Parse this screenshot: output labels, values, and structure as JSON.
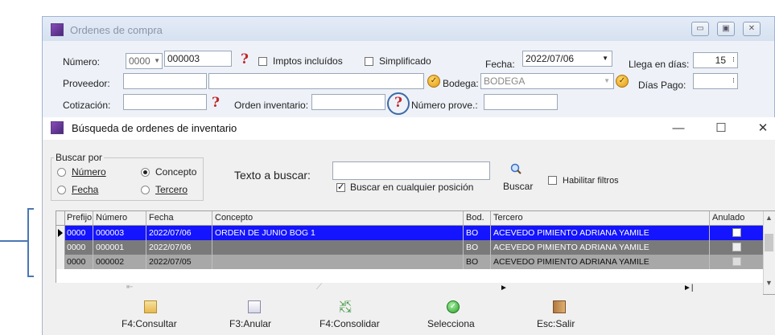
{
  "back_window": {
    "title": "Ordenes de compra",
    "numero_label": "Número:",
    "numero_prefix": "0000",
    "numero_value": "000003",
    "imptos_label": "Imptos incluídos",
    "simplificado_label": "Simplificado",
    "fecha_label": "Fecha:",
    "fecha_value": "2022/07/06",
    "llega_label": "Llega en días:",
    "llega_value": "15",
    "proveedor_label": "Proveedor:",
    "proveedor_code": "",
    "proveedor_name": "",
    "bodega_label": "Bodega:",
    "bodega_value": "BODEGA",
    "dias_pago_label": "Días Pago:",
    "dias_pago_value": "",
    "cotizacion_label": "Cotización:",
    "cotizacion_value": "",
    "orden_inv_label": "Orden inventario:",
    "orden_inv_value": "",
    "numero_prove_label": "Número prove.:",
    "numero_prove_value": ""
  },
  "dialog": {
    "title": "Búsqueda de ordenes de inventario",
    "minimize": "—",
    "maximize": "☐",
    "close": "✕",
    "buscar_por": "Buscar por",
    "radios": [
      {
        "label": "Número",
        "selected": false
      },
      {
        "label": "Concepto",
        "selected": true
      },
      {
        "label": "Fecha",
        "selected": false
      },
      {
        "label": "Tercero",
        "selected": false
      }
    ],
    "texto_label": "Texto a buscar:",
    "texto_value": "",
    "cualquier_label": "Buscar en cualquier posición",
    "cualquier_checked": true,
    "buscar_label": "Buscar",
    "filtros_label": "Habilitar filtros",
    "filtros_checked": false
  },
  "grid": {
    "columns": [
      "Prefijo",
      "Número",
      "Fecha",
      "Concepto",
      "Bod.",
      "Tercero",
      "Anulado"
    ],
    "rows": [
      {
        "prefijo": "0000",
        "numero": "000003",
        "fecha": "2022/07/06",
        "concepto": "ORDEN DE JUNIO BOG 1",
        "bod": "BO",
        "tercero": "ACEVEDO PIMIENTO ADRIANA YAMILE",
        "anulado": false
      },
      {
        "prefijo": "0000",
        "numero": "000001",
        "fecha": "2022/07/06",
        "concepto": "",
        "bod": "BO",
        "tercero": "ACEVEDO PIMIENTO ADRIANA YAMILE",
        "anulado": false
      },
      {
        "prefijo": "0000",
        "numero": "000002",
        "fecha": "2022/07/05",
        "concepto": "",
        "bod": "BO",
        "tercero": "ACEVEDO PIMIENTO ADRIANA YAMILE",
        "anulado": false
      }
    ]
  },
  "toolbar": {
    "consultar": "F4:Consultar",
    "anular": "F3:Anular",
    "consolidar": "F4:Consolidar",
    "selecciona": "Selecciona",
    "salir": "Esc:Salir"
  },
  "colors": {
    "selected_row": "#1414ff",
    "annotation": "#3d6aa6",
    "question_mark": "#c0282a"
  }
}
